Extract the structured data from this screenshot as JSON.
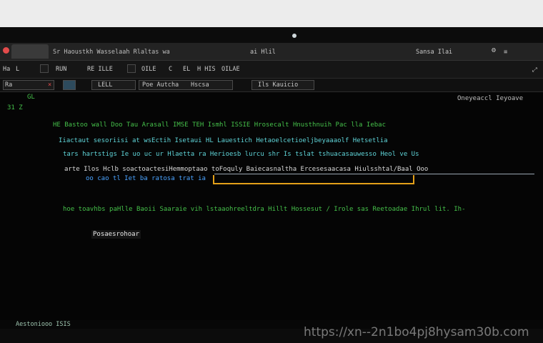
{
  "titlebar": {
    "title": "Sr Haoustkh Wasselaah Rlaltas wa",
    "center_text": "ai Hlil",
    "right_text": "Sansa Ilai"
  },
  "menubar": {
    "left_items": [
      "Ha",
      "L",
      "RUN",
      "RE ILLE",
      "OILE",
      "C",
      "EL",
      "H HIS",
      "OILAE"
    ]
  },
  "toolbar": {
    "items": [
      "Ra",
      "LELL",
      "Poe Autcha",
      "Hscsa",
      "Ils Kauicio"
    ],
    "right_text": "Oneyeaccl Ieyoave"
  },
  "gutter": {
    "marker": "31 Z",
    "marker_top": "GL"
  },
  "code_lines": [
    {
      "text": "HE Bastoo wall Doo Tau Arasall   IMSE TEH  Ismhl  ISSIE  Hrosecalt Hnusthnuih Pac lla Iebac",
      "color": "g"
    },
    {
      "text": "Iiactaut sesoriisi at wsEctih  Isetaui HL Lauestich  Hetaoelcetioeljbeyaaaolf Hetsetlia",
      "color": "c"
    },
    {
      "text": "tars hartstigs Ie  uo uc ur  Hlaetta ra Herioesb lurcu shr Is  tslat tshuacasauwesso Heol ve Us",
      "color": "c"
    },
    {
      "text": "arte Ilos Hclb   soactoactesiHemmoptaao toFoquly Baiecasnaltha Ercesesaacasa Hiulsshtal/Baal Ooo",
      "color": "w"
    },
    {
      "text": "oo  cao  tl  Iet  ba  ratosa trat  ia",
      "color": "b"
    },
    {
      "text": "hoe   toavhbs  paHlle  Baoii  Saaraie  vih  lstaaohreeltdra  Hillt  Hossesut  /  Irole  sas  Reetoadae  Ihrul  lit.  Ih-",
      "color": "g"
    }
  ],
  "autocomplete": "Posaesrohoar",
  "status": {
    "left_text": "Aestoniooo ISIS"
  },
  "watermark": "https://xn--2n1bo4pj8hysam30b.com"
}
